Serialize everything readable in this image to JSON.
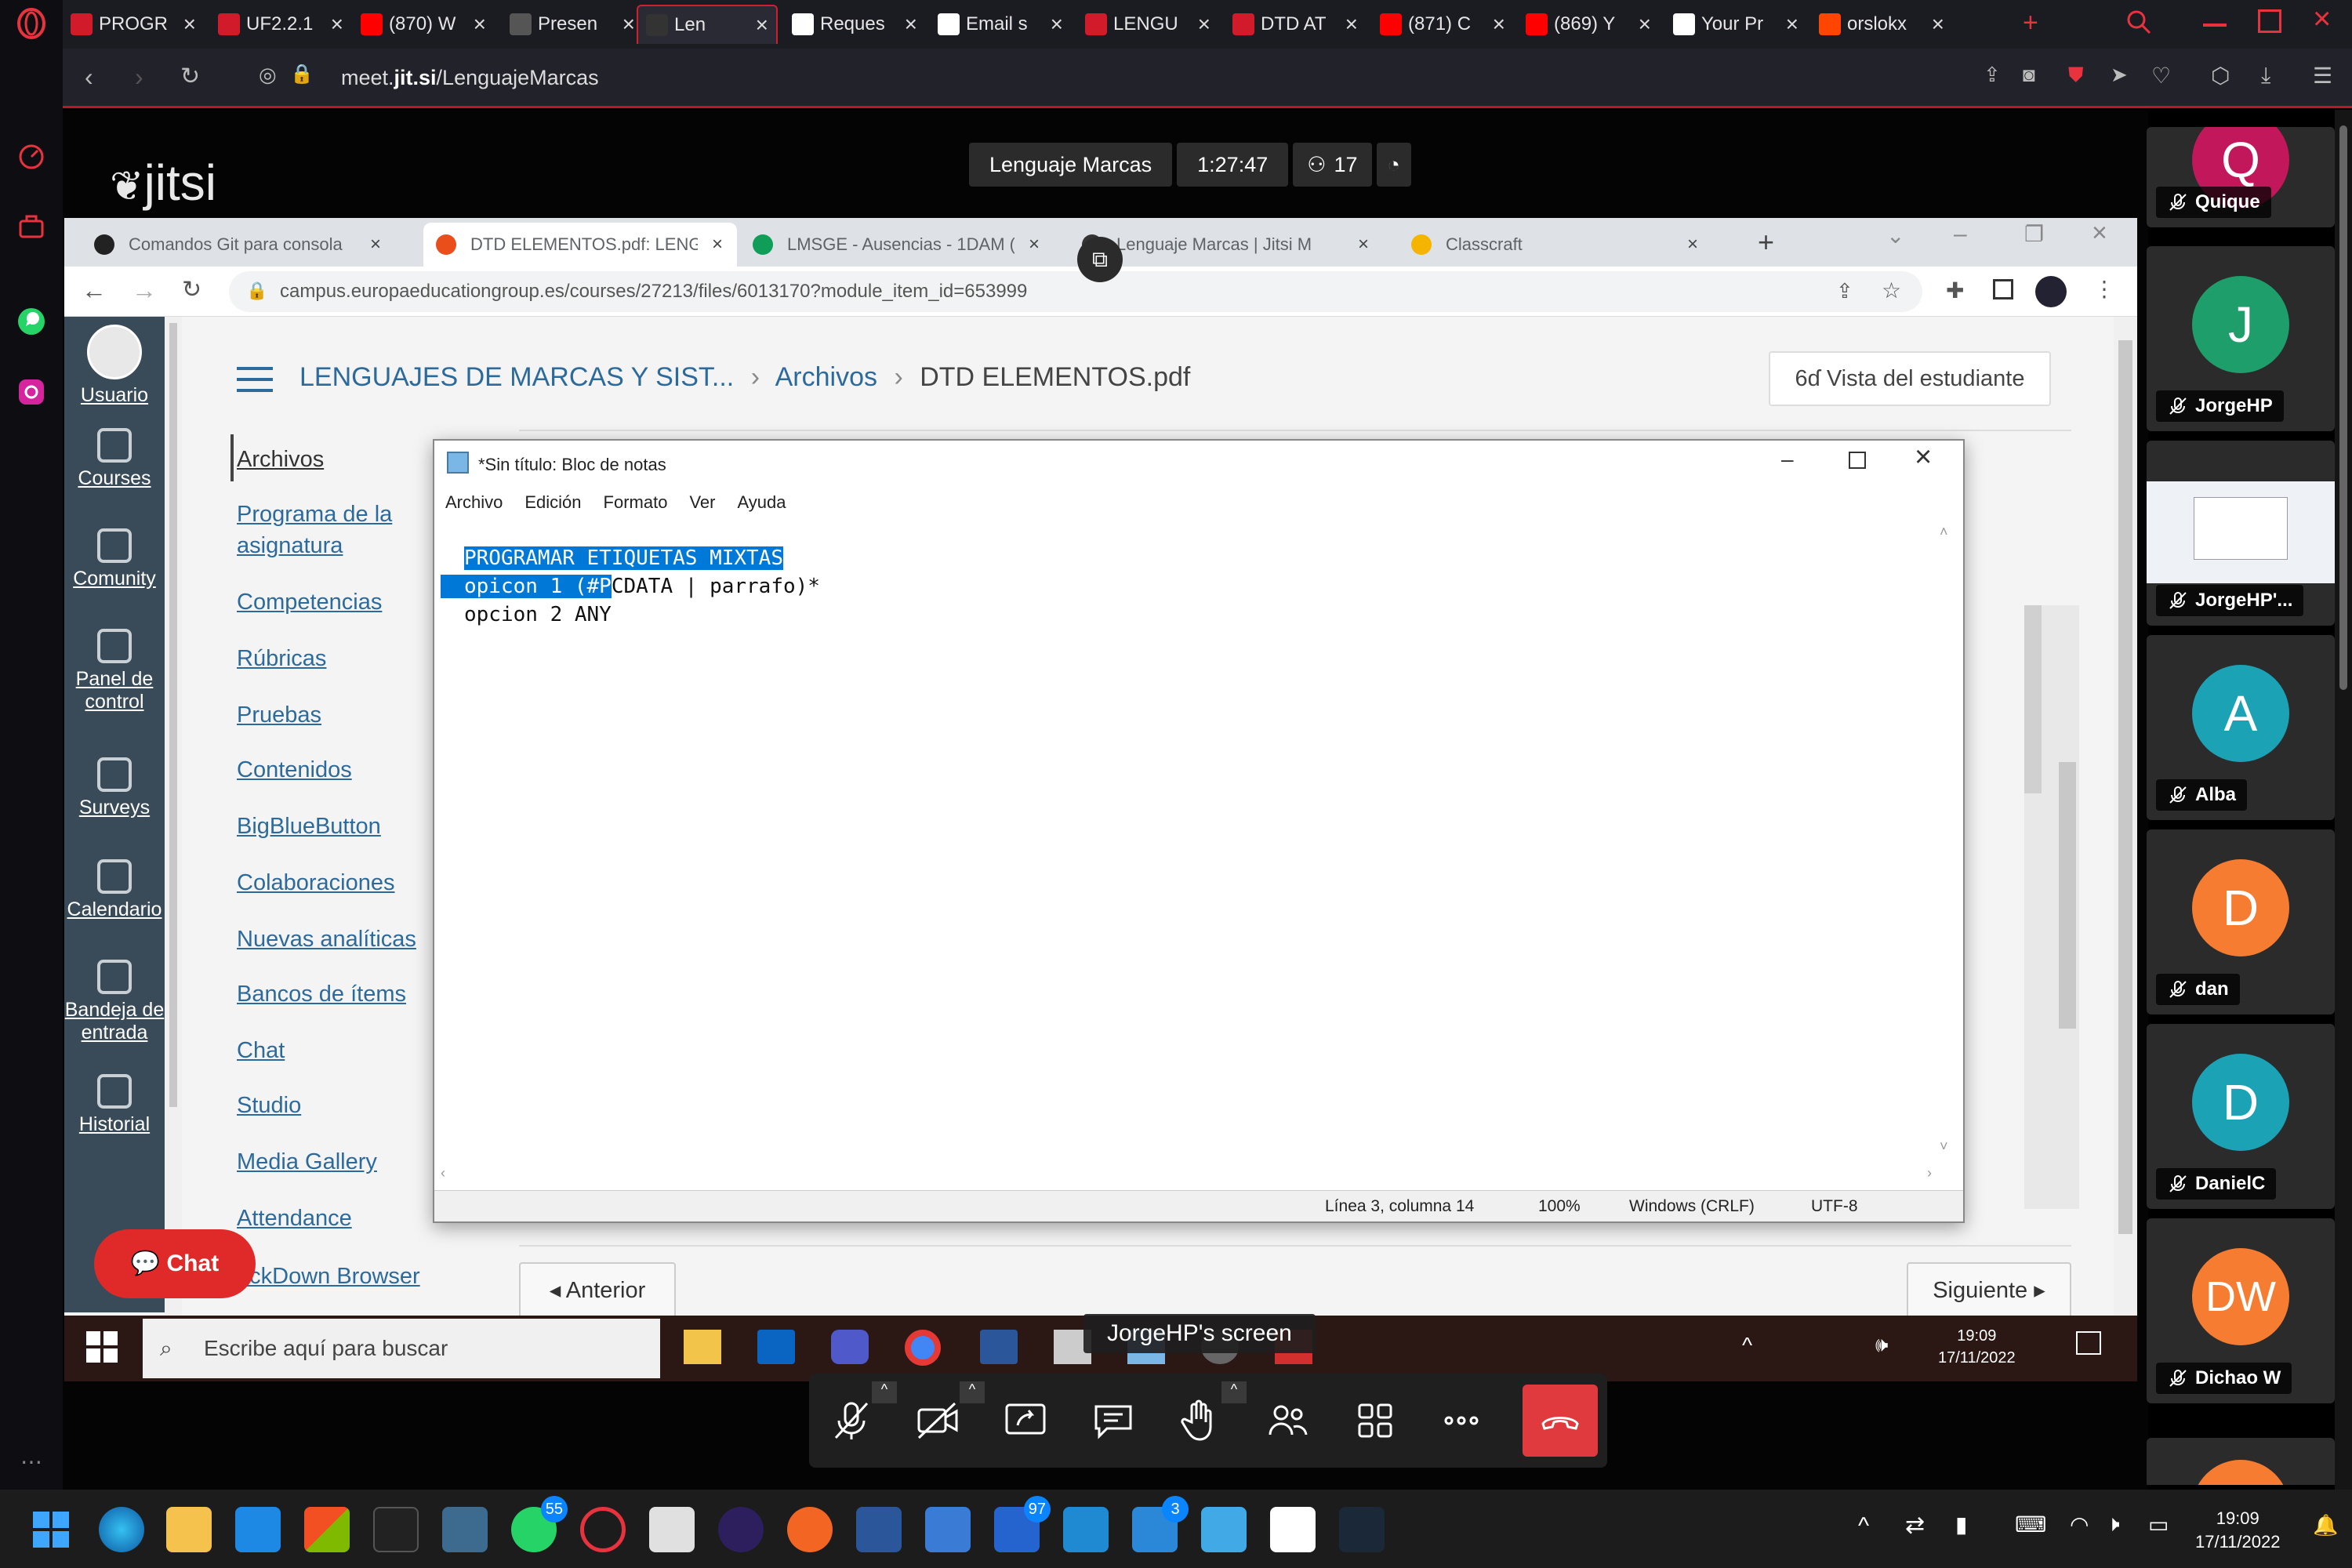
{
  "browser": {
    "tabs": [
      {
        "label": "PROGR",
        "favicon": "ue-icon",
        "fav_color": "#d11a2a"
      },
      {
        "label": "UF2.2.1",
        "favicon": "ue-icon",
        "fav_color": "#d11a2a"
      },
      {
        "label": "(870) W",
        "favicon": "youtube-icon",
        "fav_color": "#ff0000"
      },
      {
        "label": "Presen",
        "favicon": "globe-icon",
        "fav_color": "#555555"
      },
      {
        "label": "Len",
        "favicon": "jitsi-icon",
        "fav_color": "#333333",
        "active": true
      },
      {
        "label": "Reques",
        "favicon": "github-icon",
        "fav_color": "#ffffff"
      },
      {
        "label": "Email s",
        "favicon": "github-icon",
        "fav_color": "#ffffff"
      },
      {
        "label": "LENGU",
        "favicon": "ue-icon",
        "fav_color": "#d11a2a"
      },
      {
        "label": "DTD AT",
        "favicon": "ue-icon",
        "fav_color": "#d11a2a"
      },
      {
        "label": "(871) C",
        "favicon": "youtube-icon",
        "fav_color": "#ff0000"
      },
      {
        "label": "(869) Y",
        "favicon": "youtube-icon",
        "fav_color": "#ff0000"
      },
      {
        "label": "Your Pr",
        "favicon": "github-icon",
        "fav_color": "#ffffff"
      },
      {
        "label": "orslokx",
        "favicon": "reddit-icon",
        "fav_color": "#ff4500"
      }
    ],
    "url_prefix": "meet.",
    "url_host": "jit.si",
    "url_path": "/LenguajeMarcas"
  },
  "jitsi": {
    "logo": "jitsi",
    "meeting_name": "Lenguaje Marcas",
    "duration": "1:27:47",
    "participant_count": "17",
    "screen_label": "JorgeHP's screen"
  },
  "shared_screen": {
    "chrome_tabs": [
      {
        "label": "Comandos Git para consola",
        "color": "#222222"
      },
      {
        "label": "DTD ELEMENTOS.pdf: LENGU",
        "color": "#e94e1b"
      },
      {
        "label": "LMSGE - Ausencias - 1DAM (",
        "color": "#0f9d58"
      },
      {
        "label": "Lenguaje Marcas | Jitsi M",
        "color": "#333333"
      },
      {
        "label": "Classcraft",
        "color": "#f4b400"
      }
    ],
    "chrome_url": "campus.europaeducationgroup.es/courses/27213/files/6013170?module_item_id=653999",
    "canvas_nav": [
      {
        "label": "Usuario",
        "icon": "avatar"
      },
      {
        "label": "Courses",
        "icon": "book-icon"
      },
      {
        "label": "Comunity",
        "icon": "share-icon"
      },
      {
        "label": "Panel de control",
        "icon": "dashboard-icon"
      },
      {
        "label": "Surveys",
        "icon": "survey-icon"
      },
      {
        "label": "Calendario",
        "icon": "calendar-icon"
      },
      {
        "label": "Bandeja de entrada",
        "icon": "inbox-icon"
      },
      {
        "label": "Historial",
        "icon": "clock-icon"
      }
    ],
    "breadcrumb": {
      "course": "LENGUAJES DE MARCAS Y SIST...",
      "section": "Archivos",
      "current": "DTD ELEMENTOS.pdf"
    },
    "student_view": "Vista del estudiante",
    "course_menu": [
      "Archivos",
      "Programa de la asignatura",
      "Competencias",
      "Rúbricas",
      "Pruebas",
      "Contenidos",
      "BigBlueButton",
      "Colaboraciones",
      "Nuevas analíticas",
      "Bancos de ítems",
      "Chat",
      "Studio",
      "Media Gallery",
      "Attendance",
      "ockDown Browser"
    ],
    "prev_label": "◂ Anterior",
    "next_label": "Siguiente ▸",
    "chat_button": "Chat",
    "notepad": {
      "title": "*Sin título: Bloc de notas",
      "menu": [
        "Archivo",
        "Edición",
        "Formato",
        "Ver",
        "Ayuda"
      ],
      "line1": "PROGRAMAR ETIQUETAS MIXTAS",
      "line2_selected": "opicon 1 (#P",
      "line2_rest": "CDATA | parrafo)*",
      "line3": "opcion 2 ANY",
      "status": {
        "position": "Línea 3, columna 14",
        "zoom": "100%",
        "eol": "Windows (CRLF)",
        "encoding": "UTF-8"
      }
    },
    "taskbar": {
      "search_placeholder": "Escribe aquí para buscar",
      "time": "19:09",
      "date": "17/11/2022"
    }
  },
  "participants": [
    {
      "name": "Quique",
      "initial": "Q",
      "color": "#c2185b"
    },
    {
      "name": "JorgeHP",
      "initial": "J",
      "color": "#1e9e6a"
    },
    {
      "name": "JorgeHP'...",
      "initial": "",
      "color": "#2b2b2b",
      "sharing": true
    },
    {
      "name": "Alba",
      "initial": "A",
      "color": "#1ba3b5"
    },
    {
      "name": "dan",
      "initial": "D",
      "color": "#f57c30"
    },
    {
      "name": "DanielC",
      "initial": "D",
      "color": "#1ba3b5"
    },
    {
      "name": "Dichao W",
      "initial": "DW",
      "color": "#f57c30"
    }
  ],
  "system_taskbar": {
    "time": "19:09",
    "date": "17/11/2022",
    "whatsapp_badge": "55",
    "todo_badge": "97",
    "vscode_badge": "3"
  }
}
